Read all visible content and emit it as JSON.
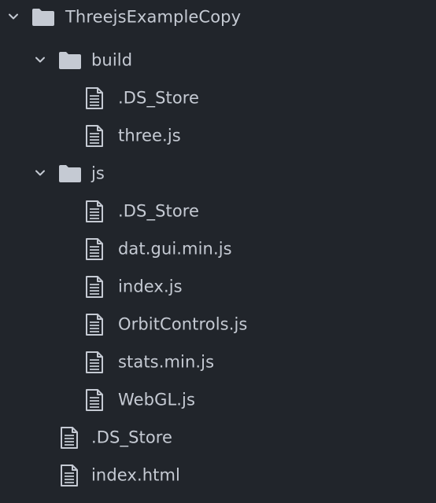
{
  "tree": {
    "root": {
      "label": "ThreejsExampleCopy",
      "expanded": true,
      "icon": "folder-icon"
    },
    "build": {
      "label": "build",
      "expanded": true,
      "icon": "folder-icon",
      "files": [
        ".DS_Store",
        "three.js"
      ]
    },
    "js": {
      "label": "js",
      "expanded": true,
      "icon": "folder-icon",
      "files": [
        ".DS_Store",
        "dat.gui.min.js",
        "index.js",
        "OrbitControls.js",
        "stats.min.js",
        "WebGL.js"
      ]
    },
    "root_files": [
      ".DS_Store",
      "index.html"
    ]
  },
  "colors": {
    "background": "#21252b",
    "text": "#c5cad3",
    "icon": "#c5cad3",
    "chevron": "#c5cad3"
  }
}
